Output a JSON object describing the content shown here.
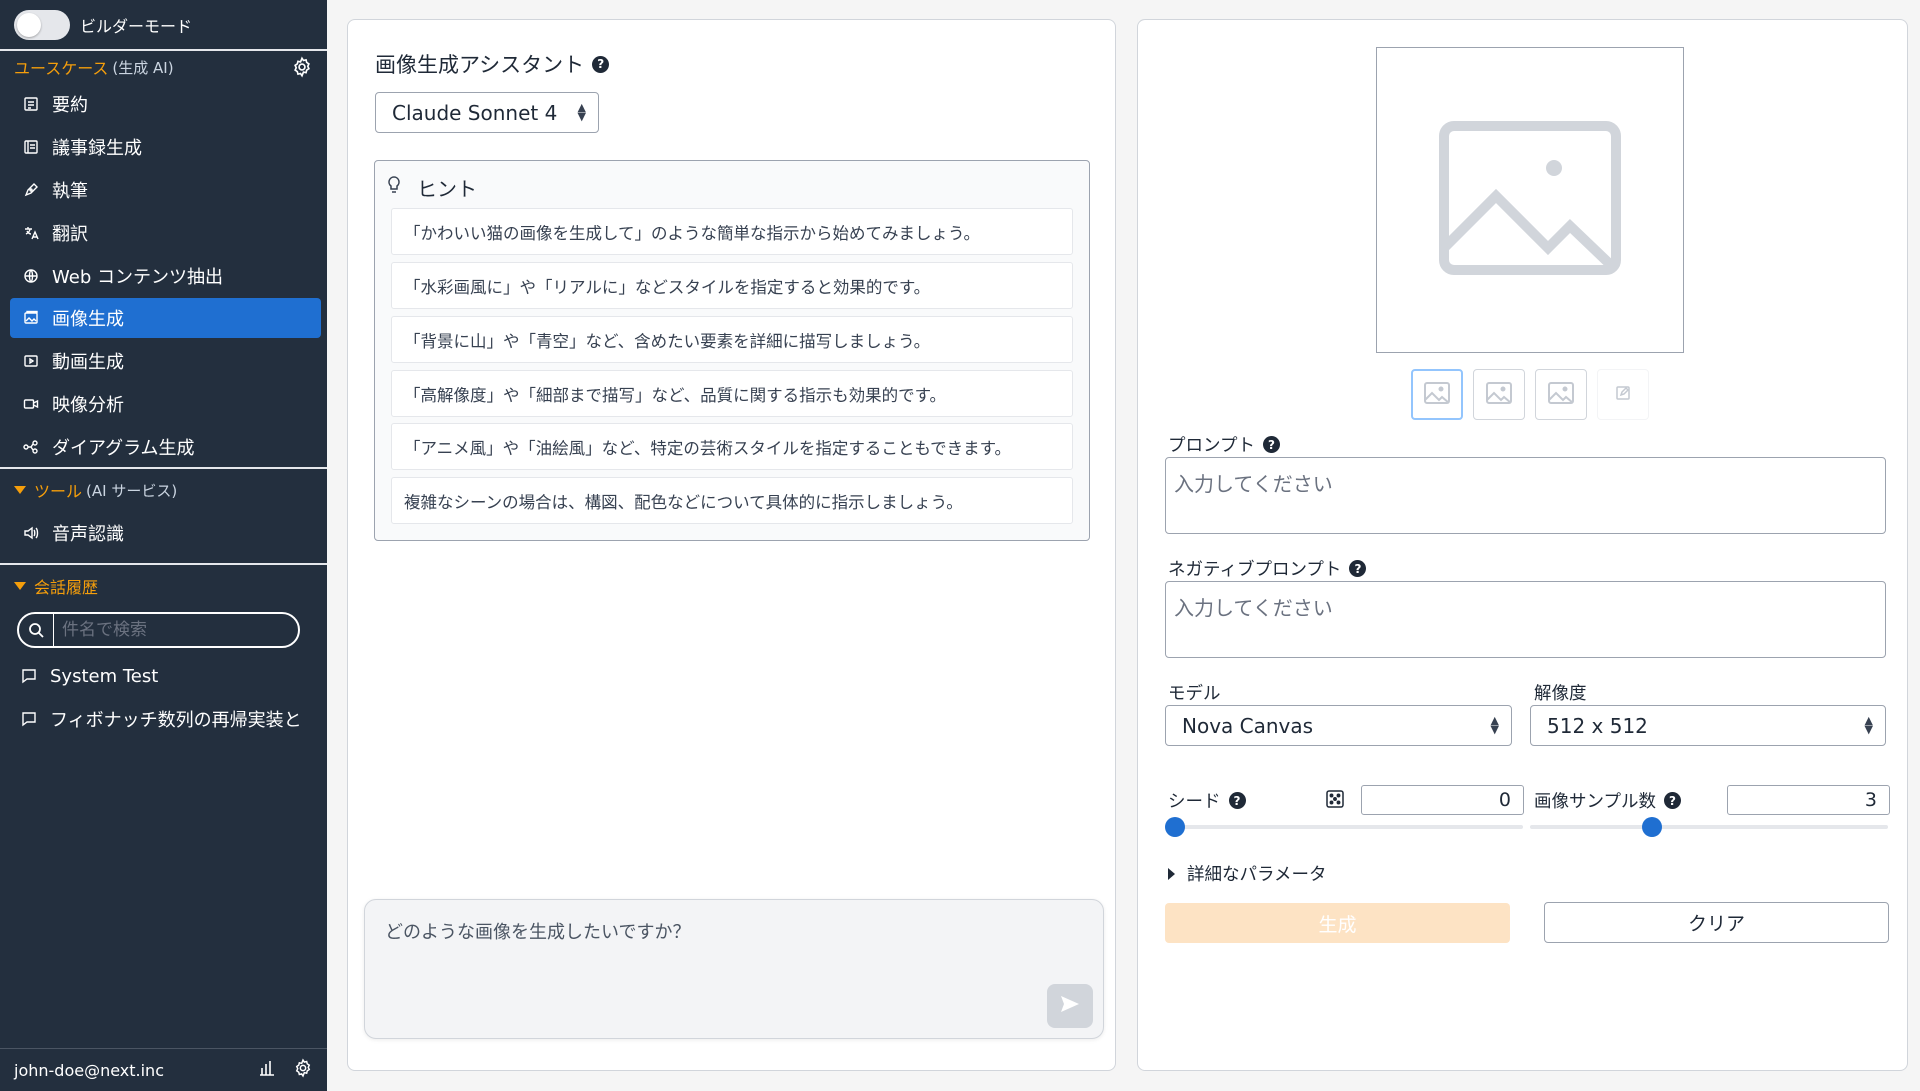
{
  "sidebar": {
    "builder_mode_label": "ビルダーモード",
    "usecases_title": "ユースケース",
    "usecases_sub": "(生成 AI)",
    "items": [
      {
        "label": "要約"
      },
      {
        "label": "議事録生成"
      },
      {
        "label": "執筆"
      },
      {
        "label": "翻訳"
      },
      {
        "label": "Web コンテンツ抽出"
      },
      {
        "label": "画像生成"
      },
      {
        "label": "動画生成"
      },
      {
        "label": "映像分析"
      },
      {
        "label": "ダイアグラム生成"
      }
    ],
    "tools_title": "ツール",
    "tools_sub": "(AI サービス)",
    "tools": [
      {
        "label": "音声認識"
      }
    ],
    "history_title": "会話履歴",
    "search_placeholder": "件名で検索",
    "history": [
      {
        "label": "System Test"
      },
      {
        "label": "フィボナッチ数列の再帰実装と"
      }
    ],
    "user_email": "john-doe@next.inc"
  },
  "assistant": {
    "title": "画像生成アシスタント",
    "model": "Claude Sonnet 4",
    "hint_title": "ヒント",
    "hints": [
      "「かわいい猫の画像を生成して」のような簡単な指示から始めてみましょう。",
      "「水彩画風に」や「リアルに」などスタイルを指定すると効果的です。",
      "「背景に山」や「青空」など、含めたい要素を詳細に描写しましょう。",
      "「高解像度」や「細部まで描写」など、品質に関する指示も効果的です。",
      "「アニメ風」や「油絵風」など、特定の芸術スタイルを指定することもできます。",
      "複雑なシーンの場合は、構図、配色などについて具体的に指示しましょう。"
    ],
    "chat_placeholder": "どのような画像を生成したいですか？"
  },
  "generator": {
    "prompt_label": "プロンプト",
    "prompt_placeholder": "入力してください",
    "negative_label": "ネガティブプロンプト",
    "negative_placeholder": "入力してください",
    "model_label": "モデル",
    "model_value": "Nova Canvas",
    "resolution_label": "解像度",
    "resolution_value": "512 x 512",
    "seed_label": "シード",
    "seed_value": "0",
    "seed_fraction": 0.0,
    "samples_label": "画像サンプル数",
    "samples_value": "3",
    "samples_fraction": 0.33,
    "details_label": "詳細なパラメータ",
    "generate_label": "生成",
    "clear_label": "クリア"
  },
  "colors": {
    "sidebar_bg": "#232f3e",
    "accent_orange": "#f59e0b",
    "active_blue": "#1f6fd1",
    "generate_disabled": "#fde3c4"
  }
}
